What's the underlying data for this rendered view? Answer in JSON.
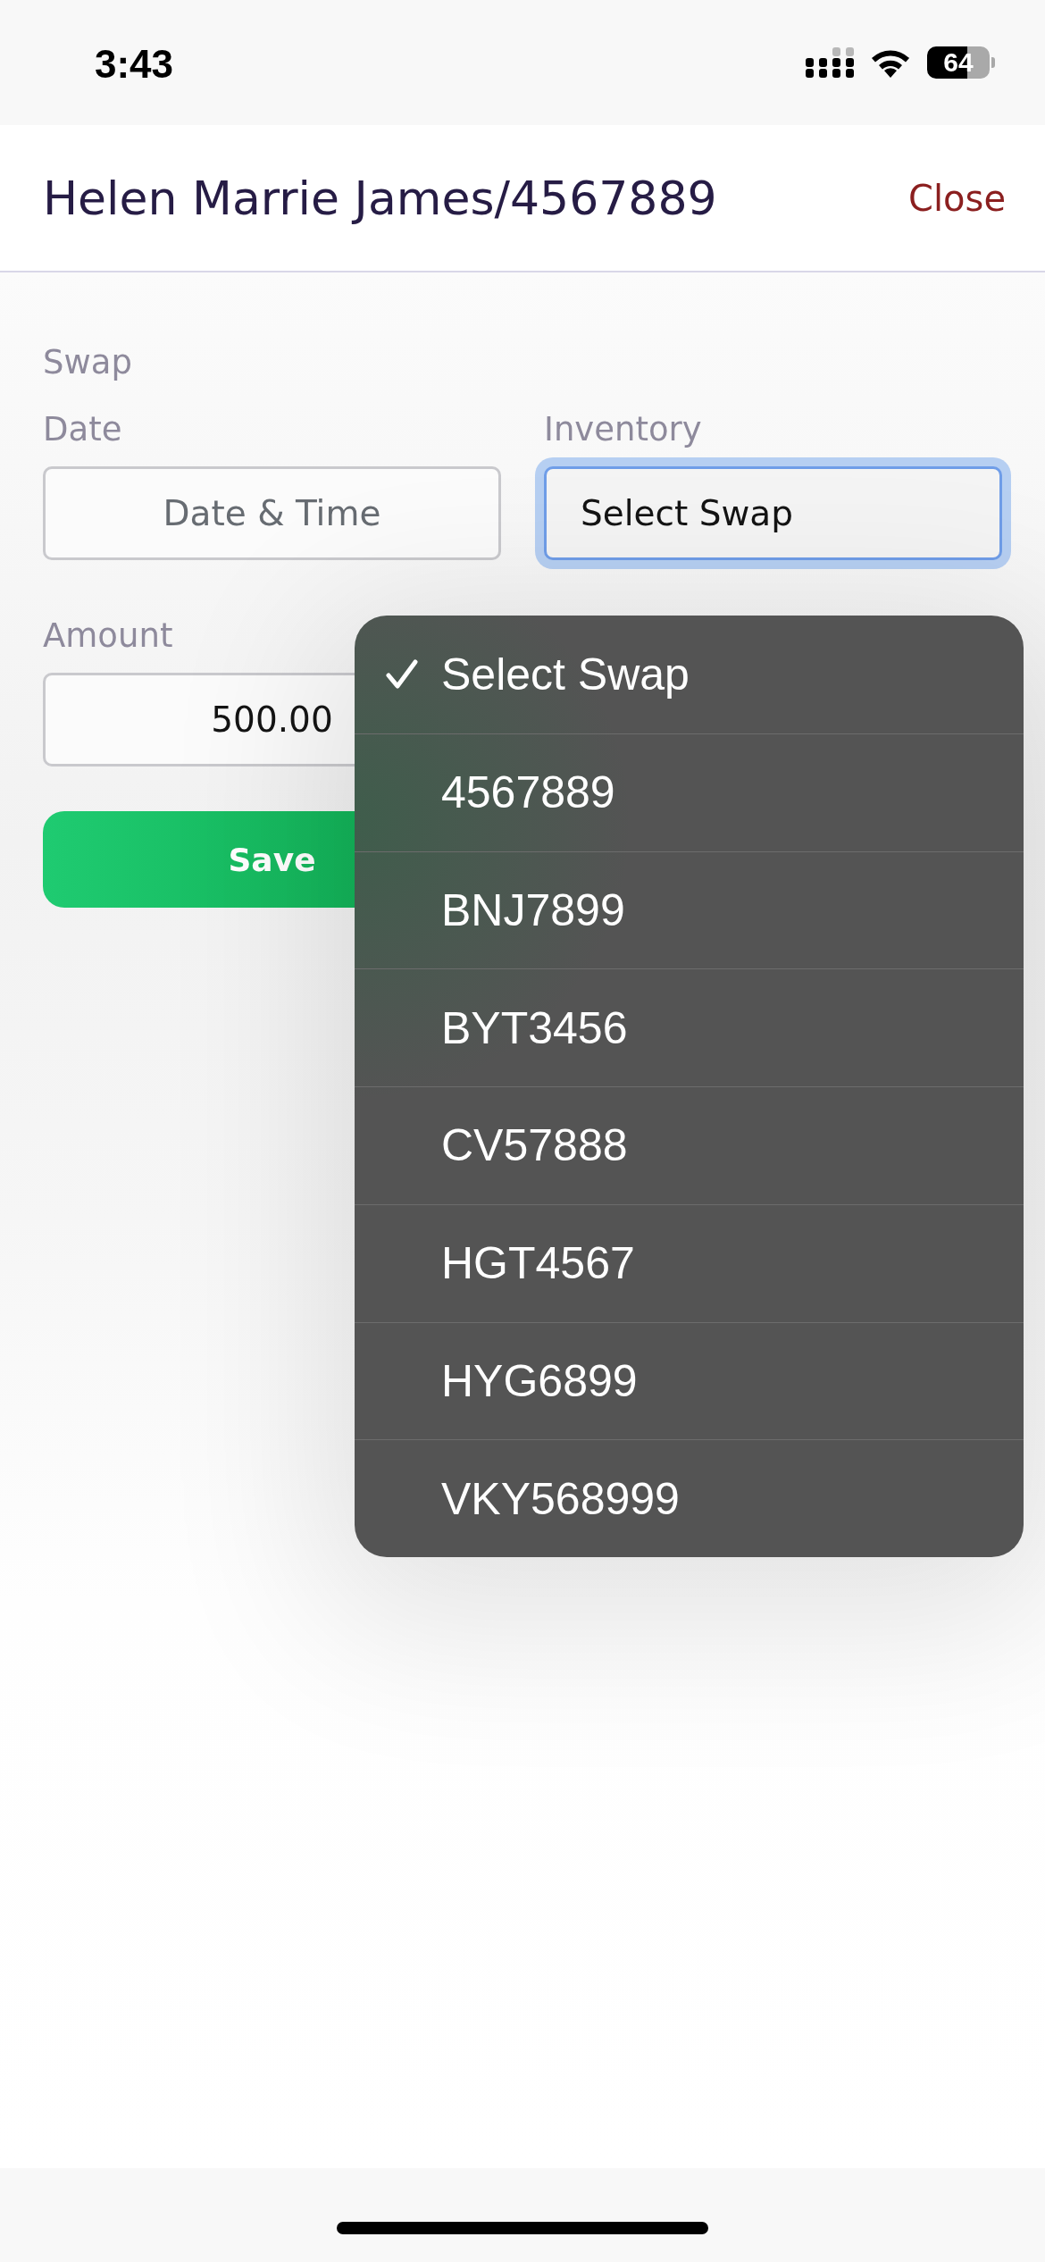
{
  "status_bar": {
    "time": "3:43",
    "battery": "64"
  },
  "header": {
    "title": "Helen Marrie James/4567889",
    "close_link": "Close"
  },
  "form": {
    "section_title": "Swap",
    "date_field": {
      "label": "Date",
      "placeholder": "Date & Time"
    },
    "inventory_field": {
      "label": "Inventory",
      "value": "Select Swap",
      "focused": true
    },
    "amount_field": {
      "label": "Amount",
      "value": "500.00"
    },
    "save_button": "Save"
  },
  "dropdown": {
    "options": [
      {
        "label": "Select Swap",
        "selected": true
      },
      {
        "label": "4567889",
        "selected": false
      },
      {
        "label": "BNJ7899",
        "selected": false
      },
      {
        "label": "BYT3456",
        "selected": false
      },
      {
        "label": "CV57888",
        "selected": false
      },
      {
        "label": "HGT4567",
        "selected": false
      },
      {
        "label": "HYG6899",
        "selected": false
      },
      {
        "label": "VKY568999",
        "selected": false
      }
    ]
  }
}
